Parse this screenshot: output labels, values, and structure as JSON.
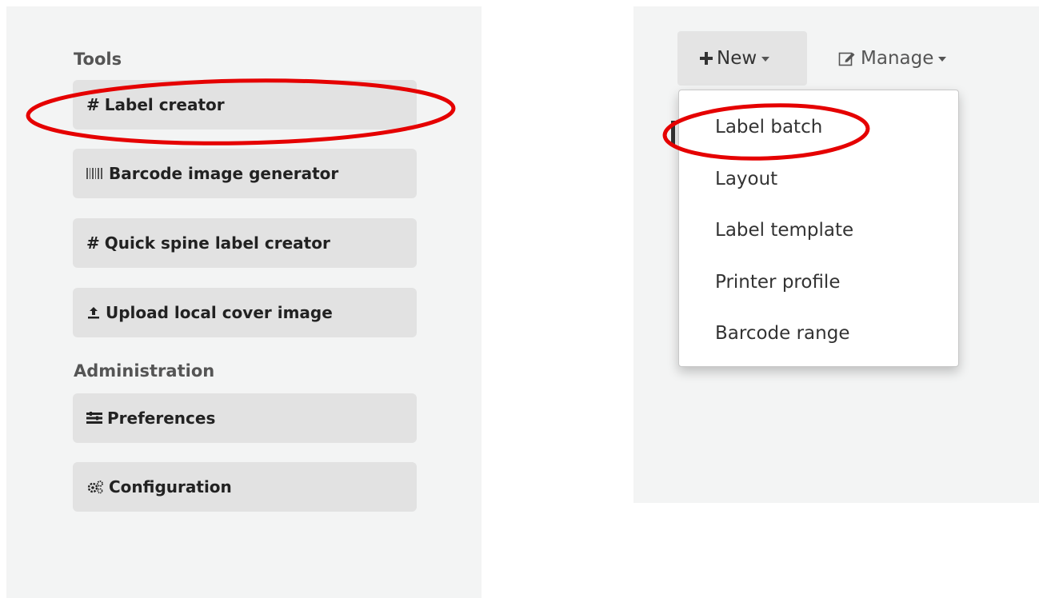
{
  "left_panel": {
    "tools_heading": "Tools",
    "admin_heading": "Administration",
    "tools": [
      {
        "icon": "hash-icon",
        "label": "Label creator"
      },
      {
        "icon": "barcode-icon",
        "label": "Barcode image generator"
      },
      {
        "icon": "hash-icon",
        "label": "Quick spine label creator"
      },
      {
        "icon": "upload-icon",
        "label": "Upload local cover image"
      }
    ],
    "admin": [
      {
        "icon": "preferences-icon",
        "label": "Preferences"
      },
      {
        "icon": "cogs-icon",
        "label": "Configuration"
      }
    ]
  },
  "right_panel": {
    "toolbar": {
      "new_label": "New",
      "new_icon": "plus-icon",
      "manage_label": "Manage",
      "manage_icon": "edit-icon"
    },
    "new_menu": [
      {
        "label": "Label batch"
      },
      {
        "label": "Layout"
      },
      {
        "label": "Label template"
      },
      {
        "label": "Printer profile"
      },
      {
        "label": "Barcode range"
      }
    ]
  },
  "colors": {
    "panel_bg": "#f3f4f4",
    "button_bg": "#e2e2e2",
    "annotation": "#e50000"
  }
}
